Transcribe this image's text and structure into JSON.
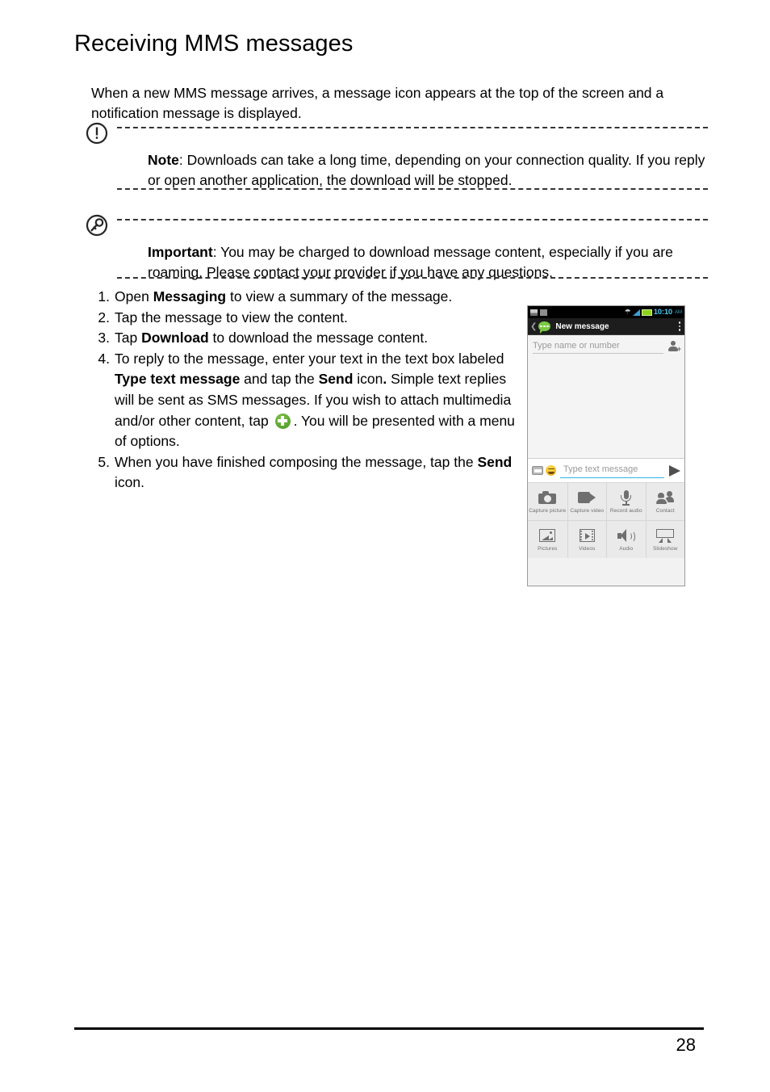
{
  "document": {
    "title": "Receiving MMS messages",
    "intro": "When a new MMS message arrives, a message icon appears at the top of the screen and a notification message is displayed.",
    "page_number": "28"
  },
  "callouts": {
    "note": {
      "icon": "exclamation-circle-icon",
      "label": "Note",
      "separator": ":",
      "text": " Downloads can take a long time, depending on your connection quality. If you reply or open another application, the download will be stopped."
    },
    "important": {
      "icon": "key-circle-icon",
      "label": "Important",
      "separator": ":",
      "text": " You may be charged to download message content, especially if you are roaming. Please contact your provider if you have any questions."
    }
  },
  "steps": [
    {
      "num": "1.",
      "parts": [
        {
          "t": "Open "
        },
        {
          "t": "Messaging",
          "b": true
        },
        {
          "t": " to view a summary of the message."
        }
      ]
    },
    {
      "num": "2.",
      "parts": [
        {
          "t": "Tap the message to view the content."
        }
      ]
    },
    {
      "num": "3.",
      "parts": [
        {
          "t": "Tap "
        },
        {
          "t": "Download",
          "b": true
        },
        {
          "t": " to download the message content."
        }
      ]
    },
    {
      "num": "4.",
      "parts": [
        {
          "t": "To reply to the message, enter your text in the text box labeled "
        },
        {
          "t": "Type text message",
          "b": true
        },
        {
          "t": " and tap the "
        },
        {
          "t": "Send",
          "b": true
        },
        {
          "t": " icon"
        },
        {
          "t": ".",
          "b": true
        },
        {
          "t": " Simple text replies will be sent as SMS messages. If you wish to attach multimedia and/or other content, tap "
        },
        {
          "icon": "green-plus-icon"
        },
        {
          "t": ". You will be presented with a menu of options."
        }
      ]
    },
    {
      "num": "5.",
      "parts": [
        {
          "t": "When you have finished composing the message, tap the "
        },
        {
          "t": "Send",
          "b": true
        },
        {
          "t": " icon."
        }
      ]
    }
  ],
  "phone_screenshot": {
    "status_bar": {
      "time": "10:10",
      "ampm": "AM",
      "icons": [
        "screenshot-icon",
        "sim-icon",
        "wifi-icon",
        "signal-icon",
        "battery-icon"
      ]
    },
    "action_bar": {
      "back_icon": "back-chevron-icon",
      "app_icon": "messaging-bubble-icon",
      "title": "New message",
      "overflow_icon": "overflow-menu-icon"
    },
    "recipient_field": {
      "placeholder": "Type name or number",
      "add_contact_icon": "add-contact-icon"
    },
    "compose_bar": {
      "keyboard_icon": "keyboard-icon",
      "emoji_icon": "emoji-icon",
      "placeholder": "Type text message",
      "send_icon": "send-arrow-icon"
    },
    "attachment_menu": [
      {
        "icon": "camera-icon",
        "label": "Capture picture"
      },
      {
        "icon": "video-camera-icon",
        "label": "Capture video"
      },
      {
        "icon": "microphone-icon",
        "label": "Record audio"
      },
      {
        "icon": "contacts-icon",
        "label": "Contact"
      },
      {
        "icon": "pictures-icon",
        "label": "Pictures"
      },
      {
        "icon": "videos-icon",
        "label": "Videos"
      },
      {
        "icon": "audio-speaker-icon",
        "label": "Audio"
      },
      {
        "icon": "slideshow-icon",
        "label": "Slideshow"
      }
    ]
  },
  "colors": {
    "accent_green": "#7ac943",
    "accent_blue": "#33b5e5",
    "status_time": "#49c6ef",
    "battery": "#8cd11c"
  }
}
